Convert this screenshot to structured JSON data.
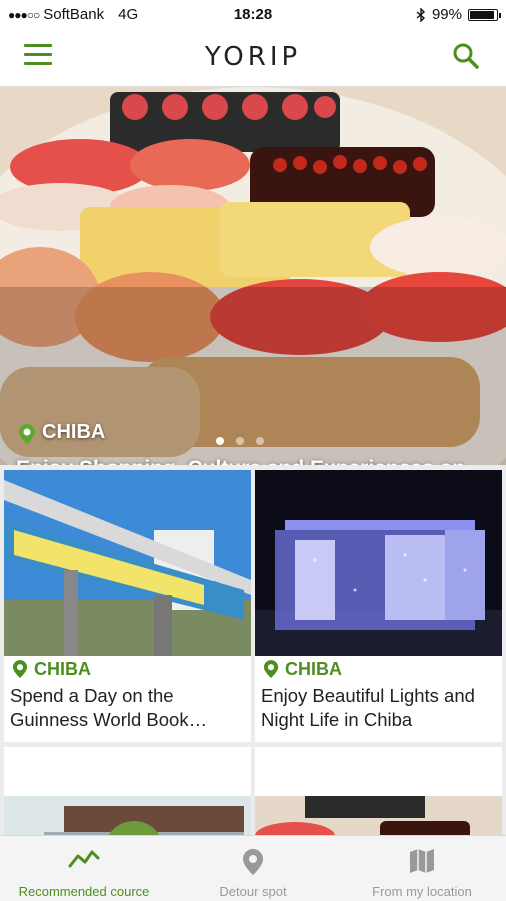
{
  "status_bar": {
    "carrier": "SoftBank",
    "network": "4G",
    "time": "18:28",
    "battery": "99%",
    "battery_level": 0.99
  },
  "header": {
    "logo": "YORIP",
    "menu_icon": "hamburger-menu-icon",
    "search_icon": "search-icon"
  },
  "hero": {
    "region": "CHIBA",
    "title": "Enjoy Shopping, Culture and Experiences on your Visit Chiba",
    "carousel_pages": 3,
    "active_page": 1
  },
  "cards": [
    {
      "region": "CHIBA",
      "title": "Spend a Day on the Guinness World Book…"
    },
    {
      "region": "CHIBA",
      "title": "Enjoy Beautiful Lights and Night Life in Chiba"
    },
    {
      "region": "",
      "title": ""
    },
    {
      "region": "",
      "title": ""
    }
  ],
  "bottom_nav": {
    "items": [
      {
        "label": "Recommended cource",
        "icon": "trend-line-icon",
        "active": true
      },
      {
        "label": "Detour spot",
        "icon": "map-pin-icon",
        "active": false
      },
      {
        "label": "From my location",
        "icon": "map-icon",
        "active": false
      }
    ]
  },
  "colors": {
    "accent": "#4d8f1f",
    "inactive": "#999999"
  }
}
